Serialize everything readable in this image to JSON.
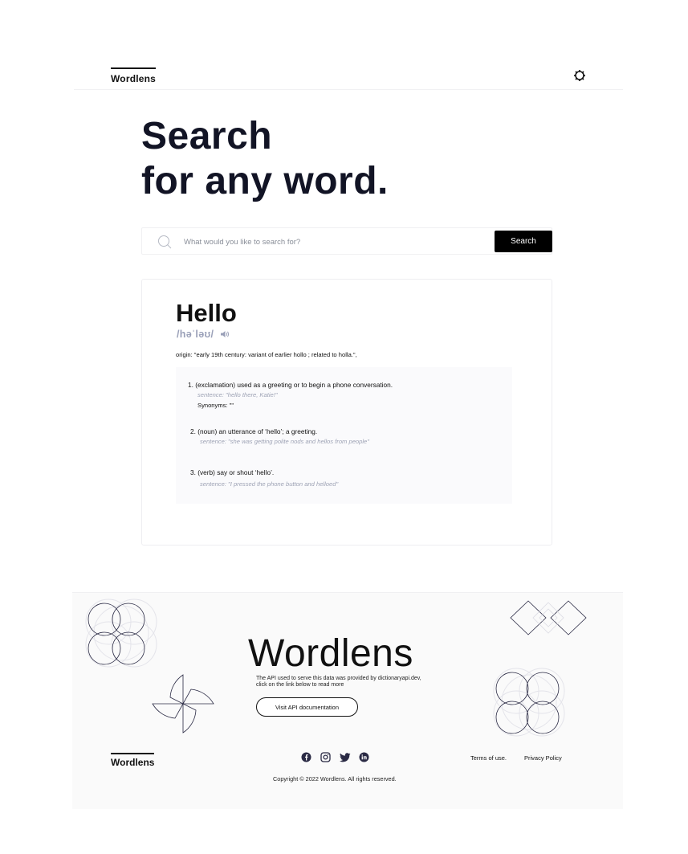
{
  "header": {
    "logo": "Wordlens",
    "theme_icon": "gear-icon"
  },
  "hero": {
    "line1": "Search",
    "line2": "for any word."
  },
  "search": {
    "placeholder": "What would you like to search for?",
    "button_label": "Search",
    "icon": "search-icon"
  },
  "result": {
    "word": "Hello",
    "phonetic": "/həˈləʊ/",
    "audio_icon": "speaker-icon",
    "origin": "origin: \"early 19th century: variant of earlier hollo ; related to holla.\",",
    "meanings": [
      {
        "text": "1. (exclamation)  used as a greeting or to begin a phone conversation.",
        "example": "sentence: \"hello there, Katie!\"",
        "synonyms": "Synonyms: \"\""
      },
      {
        "text": "2. (noun) an utterance of ‘hello’; a greeting.",
        "example": "sentence: \"she was getting polite nods and hellos from people\""
      },
      {
        "text": "3. (verb) say or shout ‘hello’.",
        "example": "sentence: \"I pressed the phone button and helloed\""
      }
    ]
  },
  "footer": {
    "title": "Wordlens",
    "description": "The API used to serve this data was provided by dictionaryapi.dev, click on the link below to read more",
    "api_button": "Visit API documentation",
    "logo": "Wordlens",
    "social_icons": [
      "facebook-icon",
      "instagram-icon",
      "twitter-icon",
      "linkedin-icon"
    ],
    "terms": "Terms of use.",
    "privacy": "Privacy Policy",
    "copyright": "Copyright © 2022 Wordlens. All rights reserved."
  },
  "colors": {
    "hero_text": "#121425",
    "phonetic": "#9aa0b8",
    "example": "#9ea3b5",
    "button_bg": "#000000",
    "footer_bg": "#fafafa"
  }
}
